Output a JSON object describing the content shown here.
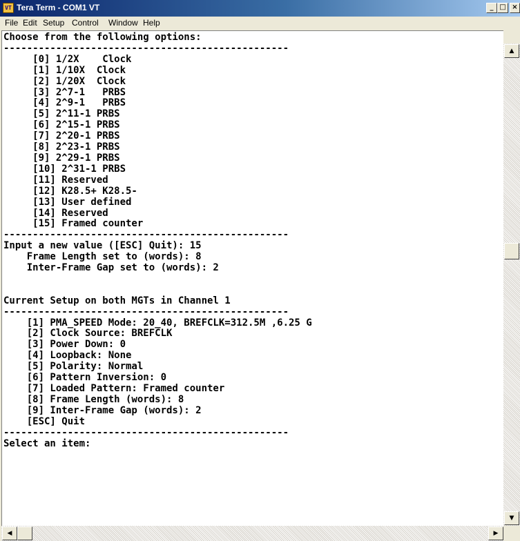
{
  "window": {
    "icon_label": "VT",
    "title": "Tera Term - COM1 VT",
    "minimize_glyph": "_",
    "maximize_glyph": "□",
    "close_glyph": "×"
  },
  "menu": {
    "items": [
      "File",
      "Edit",
      "Setup",
      "Control",
      "Window",
      "Help"
    ]
  },
  "terminal": {
    "lines": [
      "Choose from the following options:",
      "-------------------------------------------------",
      "     [0] 1/2X    Clock",
      "     [1] 1/10X  Clock",
      "     [2] 1/20X  Clock",
      "     [3] 2^7-1   PRBS",
      "     [4] 2^9-1   PRBS",
      "     [5] 2^11-1 PRBS",
      "     [6] 2^15-1 PRBS",
      "     [7] 2^20-1 PRBS",
      "     [8] 2^23-1 PRBS",
      "     [9] 2^29-1 PRBS",
      "     [10] 2^31-1 PRBS",
      "     [11] Reserved",
      "     [12] K28.5+ K28.5-",
      "     [13] User defined",
      "     [14] Reserved",
      "     [15] Framed counter",
      "-------------------------------------------------",
      "Input a new value ([ESC] Quit): 15",
      "    Frame Length set to (words): 8",
      "    Inter-Frame Gap set to (words): 2",
      "",
      "",
      "Current Setup on both MGTs in Channel 1",
      "-------------------------------------------------",
      "    [1] PMA_SPEED Mode: 20_40, BREFCLK=312.5M ,6.25 G",
      "    [2] Clock Source: BREFCLK",
      "    [3] Power Down: 0",
      "    [4] Loopback: None",
      "    [5] Polarity: Normal",
      "    [6] Pattern Inversion: 0",
      "    [7] Loaded Pattern: Framed counter",
      "    [8] Frame Length (words): 8",
      "    [9] Inter-Frame Gap (words): 2",
      "    [ESC] Quit",
      "-------------------------------------------------",
      "Select an item:"
    ]
  },
  "scrollbars": {
    "up_arrow": "▲",
    "down_arrow": "▼",
    "left_arrow": "◀",
    "right_arrow": "▶"
  }
}
